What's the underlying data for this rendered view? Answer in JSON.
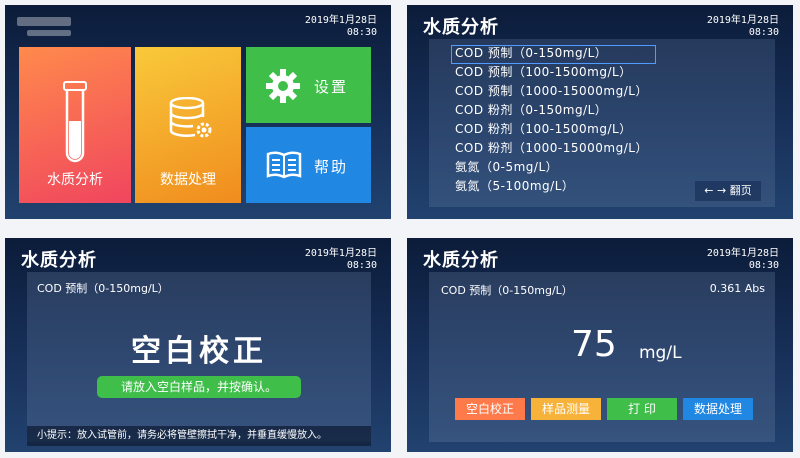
{
  "datetime": {
    "date": "2019年1月28日",
    "time": "08:30"
  },
  "home": {
    "tiles": [
      {
        "label": "水质分析",
        "icon": "test-tube-icon"
      },
      {
        "label": "数据处理",
        "icon": "database-gear-icon"
      },
      {
        "label": "设置",
        "icon": "gear-icon"
      },
      {
        "label": "帮助",
        "icon": "book-icon"
      }
    ],
    "colors": {
      "water": "#f0455e",
      "data": "#f9c93a",
      "settings": "#3fbe4a",
      "help": "#2087e3"
    }
  },
  "method_list": {
    "title": "水质分析",
    "items": [
      "COD 预制（0-150mg/L）",
      "COD 预制（100-1500mg/L）",
      "COD 预制（1000-15000mg/L）",
      "COD 粉剂（0-150mg/L）",
      "COD 粉剂（100-1500mg/L）",
      "COD 粉剂（1000-15000mg/L）",
      "氨氮（0-5mg/L）",
      "氨氮（5-100mg/L）"
    ],
    "page_button": "← → 翻页"
  },
  "blank_calibration": {
    "title": "水质分析",
    "method": "COD 预制（0-150mg/L）",
    "heading": "空白校正",
    "prompt_button": "请放入空白样品，并按确认。",
    "tip": "小提示：放入试管前，请务必将管壁擦拭干净，并垂直缓慢放入。"
  },
  "measurement": {
    "title": "水质分析",
    "method": "COD 预制（0-150mg/L）",
    "absorbance": "0.361 Abs",
    "value": "75",
    "unit": "mg/L",
    "buttons": [
      "空白校正",
      "样品测量",
      "打 印",
      "数据处理"
    ]
  }
}
